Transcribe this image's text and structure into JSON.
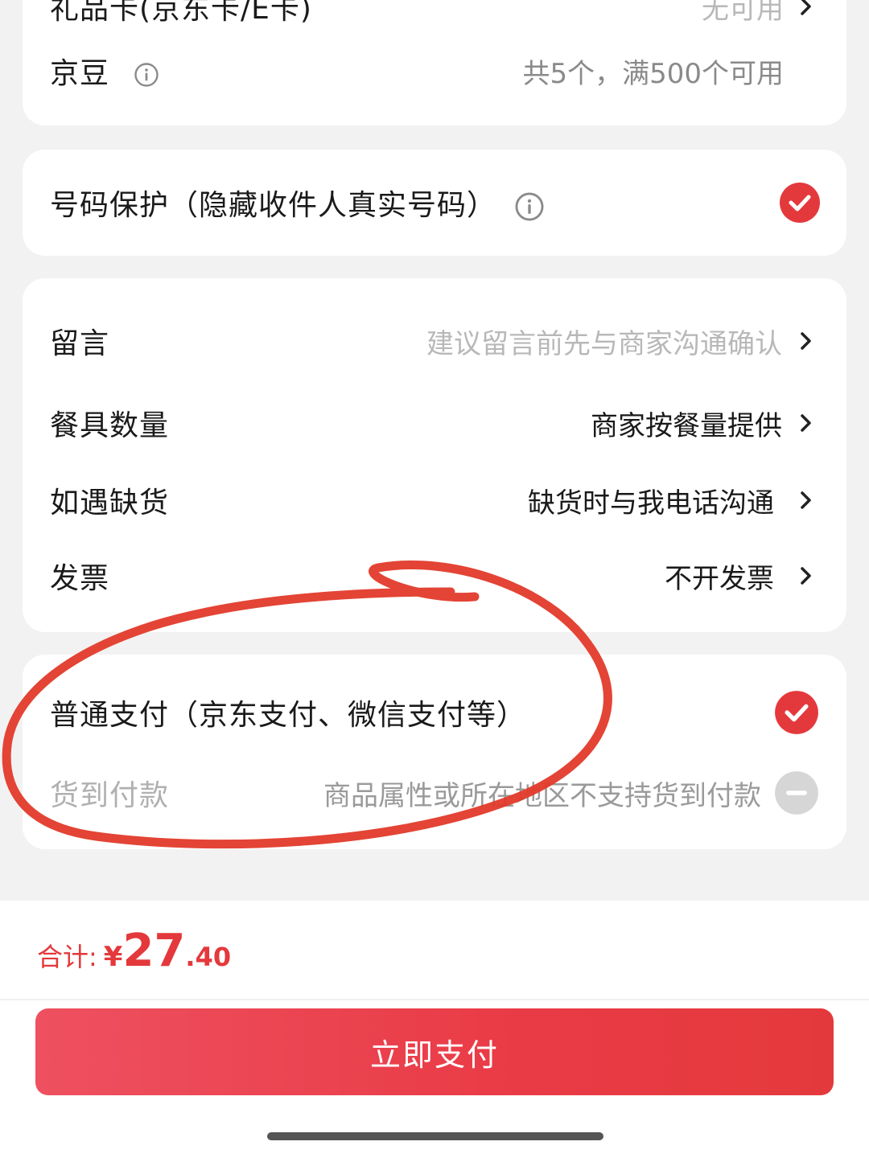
{
  "top_card": {
    "gift_card_label": "礼品卡(京东卡/E卡)",
    "gift_card_value": "无可用",
    "beans_label": "京豆",
    "beans_value": "共5个，满500个可用"
  },
  "privacy": {
    "label": "号码保护（隐藏收件人真实号码）",
    "checked": true
  },
  "options": {
    "message_label": "留言",
    "message_placeholder": "建议留言前先与商家沟通确认",
    "tableware_label": "餐具数量",
    "tableware_value": "商家按餐量提供",
    "stockout_label": "如遇缺货",
    "stockout_value": "缺货时与我电话沟通",
    "invoice_label": "发票",
    "invoice_value": "不开发票"
  },
  "payment": {
    "normal_label": "普通支付（京东支付、微信支付等）",
    "normal_selected": true,
    "cod_label": "货到付款",
    "cod_note": "商品属性或所在地区不支持货到付款",
    "cod_enabled": false
  },
  "footer": {
    "total_label": "合计:",
    "currency": "¥",
    "total_integer": "27",
    "total_decimal": ".40",
    "pay_button": "立即支付"
  },
  "colors": {
    "accent": "#e4393c",
    "annotation": "#e23a2a",
    "background": "#f2f2f2"
  },
  "icons": [
    "info-icon",
    "check-circle-icon",
    "chevron-right-icon",
    "disabled-circle-icon"
  ]
}
